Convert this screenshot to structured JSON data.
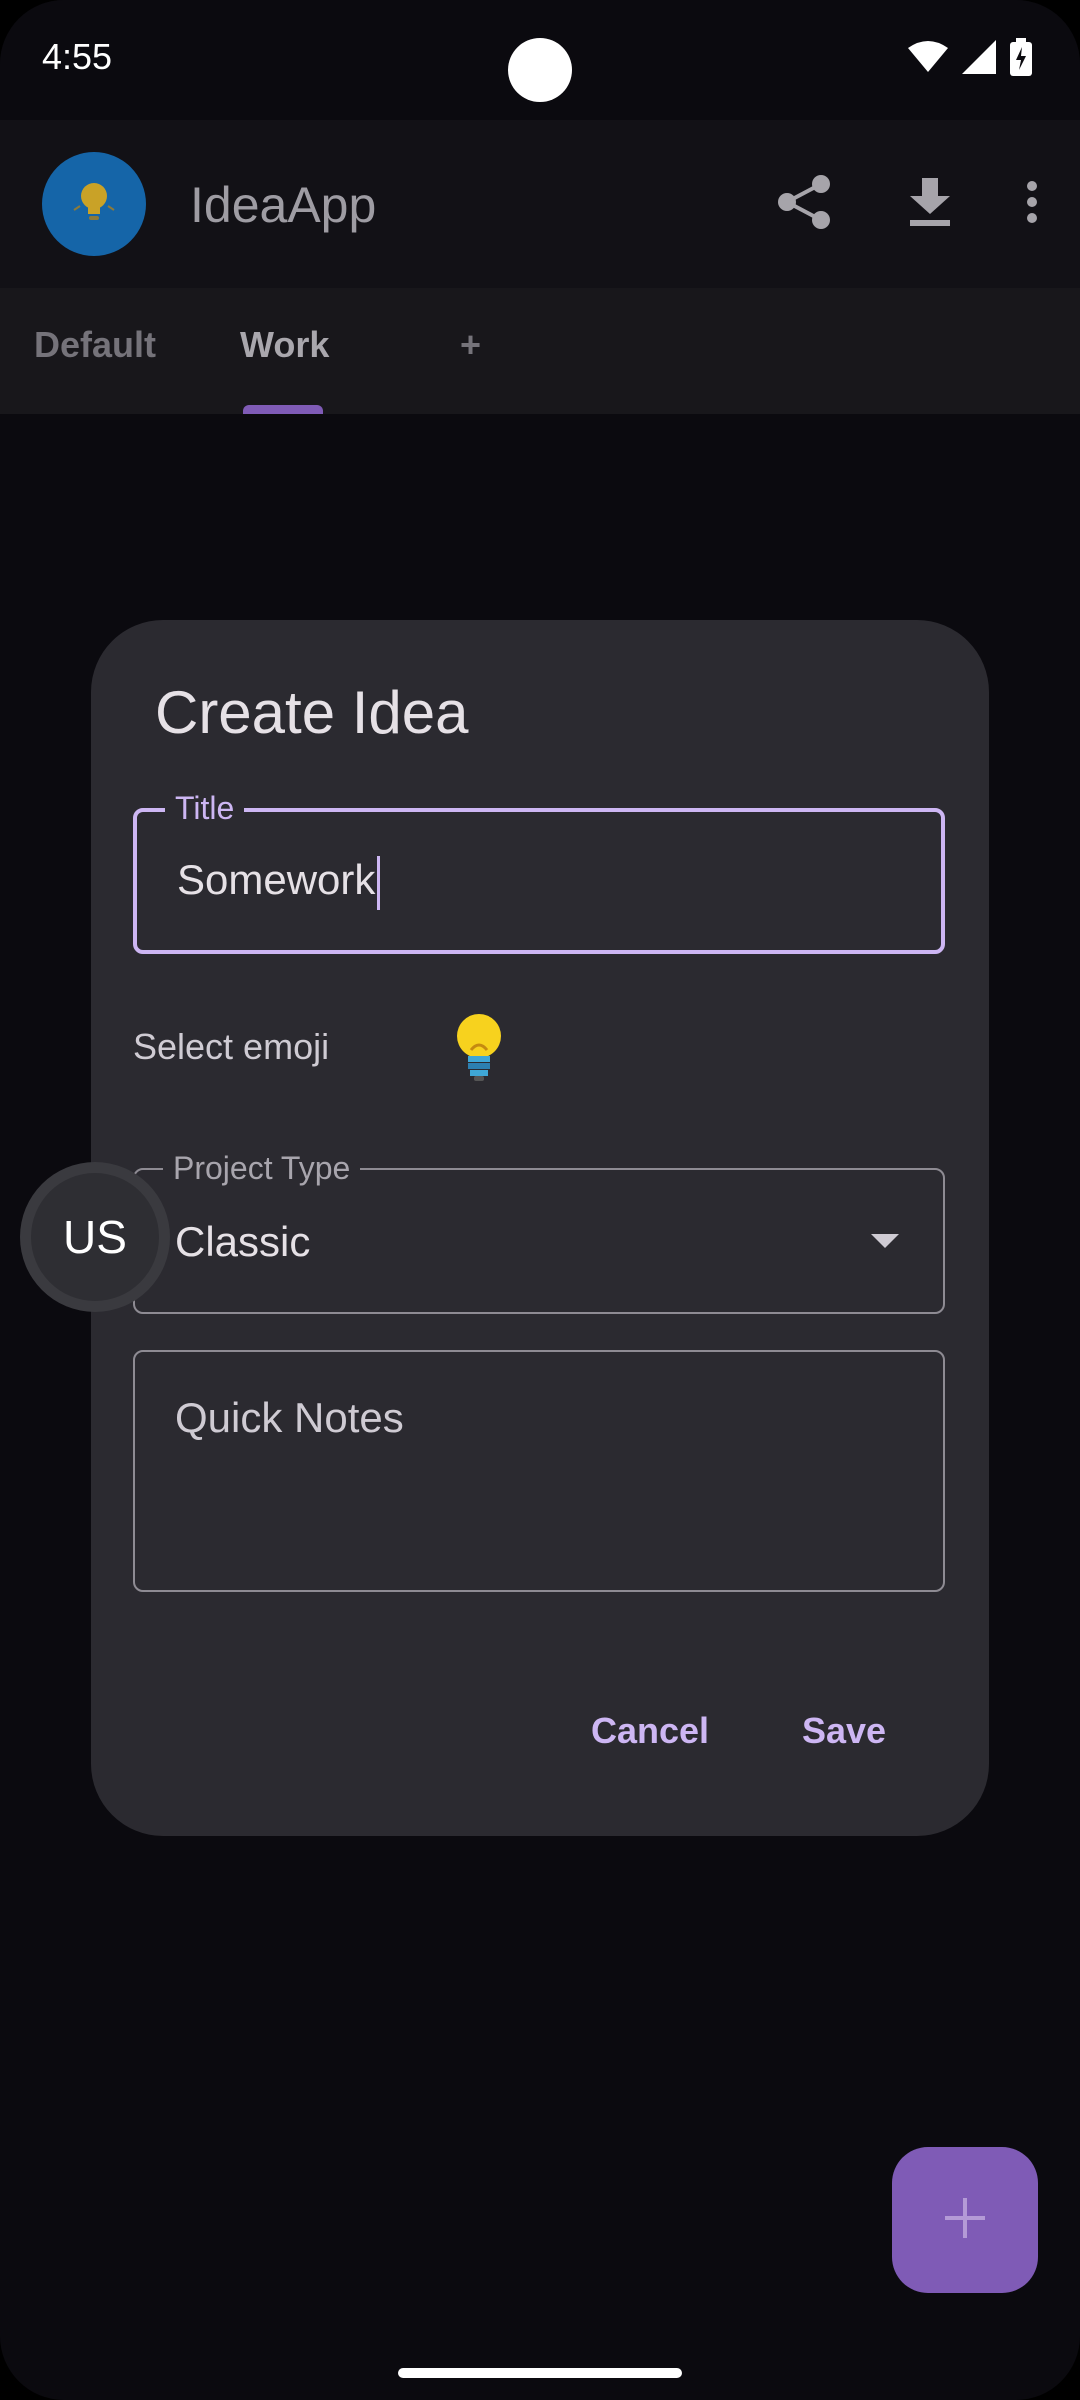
{
  "status_bar": {
    "time": "4:55",
    "icons": [
      "wifi-icon",
      "cellular-signal-icon",
      "battery-charging-icon"
    ]
  },
  "app_bar": {
    "title": "IdeaApp",
    "logo_icon": "lightbulb-icon",
    "actions": [
      "share-icon",
      "download-icon",
      "more-vert-icon"
    ]
  },
  "tabs": {
    "items": [
      {
        "label": "Default",
        "active": false
      },
      {
        "label": "Work",
        "active": true
      },
      {
        "label": "+",
        "active": false
      }
    ]
  },
  "dialog": {
    "title": "Create Idea",
    "title_field": {
      "label": "Title",
      "value": "Somework"
    },
    "emoji": {
      "label": "Select emoji",
      "value": "💡"
    },
    "project_type": {
      "label": "Project Type",
      "value": "Classic"
    },
    "notes": {
      "placeholder": "Quick Notes"
    },
    "cancel_label": "Cancel",
    "save_label": "Save"
  },
  "floating_bubble": {
    "label": "US"
  },
  "fab": {
    "icon": "plus-icon"
  },
  "colors": {
    "accent": "#7f5bb6",
    "accent_light": "#cdb6f3",
    "background": "#0b0a0f",
    "dialog": "#2b2a30",
    "logo_bg": "#1565a8"
  }
}
